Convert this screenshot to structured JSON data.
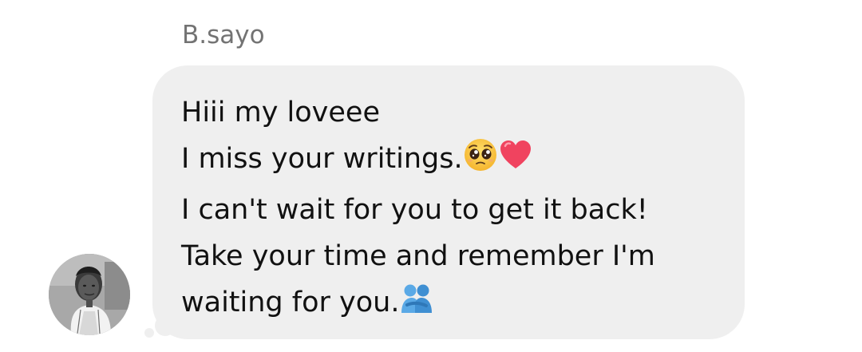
{
  "sender": {
    "name": "B.sayo"
  },
  "message": {
    "line1": "Hiii my loveee",
    "line2_text": "I miss your writings.",
    "line2_emoji1": "pleading-face-icon",
    "line2_emoji2": "red-heart-icon",
    "line3": "I can't wait for you to get it back!",
    "line4": "Take your time and remember I'm",
    "line5_text": "waiting for you.",
    "line5_emoji": "people-hugging-icon"
  },
  "colors": {
    "bubble": "#efefef",
    "name": "#737373",
    "text": "#111111"
  }
}
